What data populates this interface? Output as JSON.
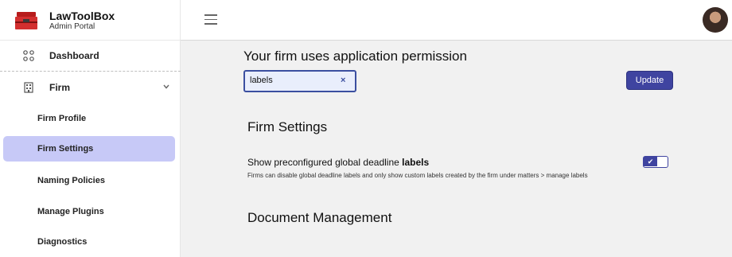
{
  "brand": {
    "title": "LawToolBox",
    "subtitle": "Admin Portal"
  },
  "nav": {
    "dashboard": "Dashboard",
    "firm": "Firm",
    "subitems": [
      {
        "label": "Firm Profile",
        "active": false
      },
      {
        "label": "Firm Settings",
        "active": true
      },
      {
        "label": "Naming Policies",
        "active": false
      },
      {
        "label": "Manage Plugins",
        "active": false
      },
      {
        "label": "Diagnostics",
        "active": false
      }
    ]
  },
  "main": {
    "permission_title": "Your firm uses application permission",
    "search": {
      "value": "labels",
      "clear": "×"
    },
    "update_label": "Update",
    "firm_settings_title": "Firm Settings",
    "setting": {
      "label_prefix": "Show preconfigured global deadline ",
      "label_bold": "labels",
      "description": "Firms can disable global deadline labels and only show custom labels created by the firm under matters > manage labels",
      "enabled": true,
      "check": "✔"
    },
    "document_management_title": "Document Management"
  },
  "colors": {
    "accent": "#3f44a0",
    "active_nav": "#c7c9f7",
    "main_bg": "#f1f1f1"
  }
}
